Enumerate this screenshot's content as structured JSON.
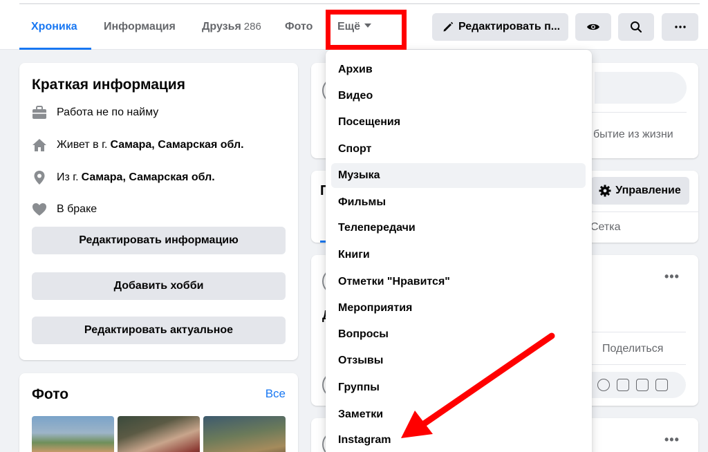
{
  "tabs": {
    "timeline": "Хроника",
    "info": "Информация",
    "friends": "Друзья",
    "friends_count": "286",
    "photos": "Фото",
    "more": "Ещё"
  },
  "header_buttons": {
    "edit_profile": "Редактировать п..."
  },
  "intro": {
    "title": "Краткая информация",
    "work": "Работа не по найму",
    "lives_prefix": "Живет в г.",
    "lives_place": "Самара, Самарская обл.",
    "from_prefix": "Из г.",
    "from_place": "Самара, Самарская обл.",
    "relationship": "В браке",
    "edit_info": "Редактировать информацию",
    "add_hobby": "Добавить хобби",
    "edit_featured": "Редактировать актуальное"
  },
  "photos": {
    "title": "Фото",
    "all": "Все"
  },
  "right_column": {
    "life_event_fragment": "бытие из жизни",
    "manage": "Управление",
    "grid_fragment": "Сетка",
    "share_fragment": "Поделиться",
    "partial_title_letter": "П",
    "partial_letter_2": "Д"
  },
  "dropdown": {
    "items": [
      "Архив",
      "Видео",
      "Посещения",
      "Спорт",
      "Музыка",
      "Фильмы",
      "Телепередачи",
      "Книги",
      "Отметки \"Нравится\"",
      "Мероприятия",
      "Вопросы",
      "Отзывы",
      "Группы",
      "Заметки",
      "Instagram"
    ],
    "highlighted_item": "Музыка"
  },
  "colors": {
    "accent": "#1877f2",
    "annotation": "#ff0000"
  }
}
